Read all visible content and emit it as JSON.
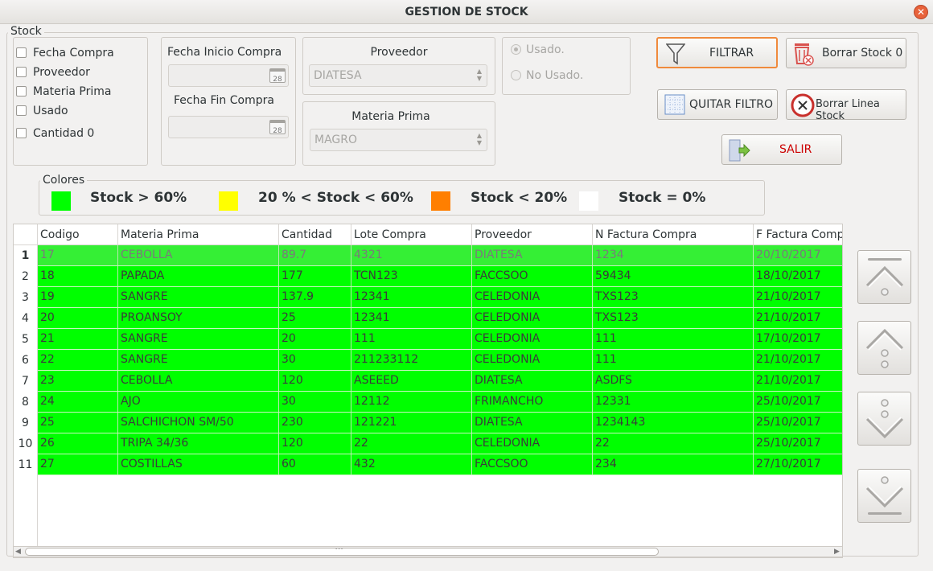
{
  "window": {
    "title": "GESTION DE STOCK"
  },
  "stock_group": {
    "title": "Stock",
    "checkboxes": [
      "Fecha Compra",
      "Proveedor",
      "Materia Prima",
      "Usado",
      "Cantidad 0"
    ]
  },
  "dates": {
    "start_label": "Fecha Inicio Compra",
    "end_label": "Fecha Fin Compra",
    "cal_icon_text": "28"
  },
  "proveedor": {
    "label": "Proveedor",
    "value": "DIATESA"
  },
  "materia": {
    "label": "Materia Prima",
    "value": "MAGRO"
  },
  "usage": {
    "used": "Usado.",
    "not_used": "No Usado."
  },
  "buttons": {
    "filter": "FILTRAR",
    "delete_stock0": "Borrar Stock 0",
    "remove_filter": "QUITAR FILTRO",
    "delete_line": "Borrar Linea Stock",
    "exit": "SALIR"
  },
  "legend": {
    "title": "Colores",
    "items": [
      {
        "color": "#00ff00",
        "label": "Stock > 60%"
      },
      {
        "color": "#ffff00",
        "label": "20 % < Stock < 60%"
      },
      {
        "color": "#ff7f00",
        "label": "Stock < 20%"
      },
      {
        "color": "#ffffff",
        "label": "Stock = 0%"
      }
    ]
  },
  "table": {
    "columns": [
      "Codigo",
      "Materia Prima",
      "Cantidad",
      "Lote Compra",
      "Proveedor",
      "N Factura Compra",
      "F Factura Compra"
    ],
    "row_numbers": [
      "1",
      "2",
      "3",
      "4",
      "5",
      "6",
      "7",
      "8",
      "9",
      "10",
      "11"
    ],
    "rows": [
      [
        "17",
        "CEBOLLA",
        "89.7",
        "4321",
        "DIATESA",
        "1234",
        "20/10/2017"
      ],
      [
        "18",
        "PAPADA",
        "177",
        "TCN123",
        "FACCSOO",
        "59434",
        "18/10/2017"
      ],
      [
        "19",
        "SANGRE",
        "137.9",
        "12341",
        "CELEDONIA",
        "TXS123",
        "21/10/2017"
      ],
      [
        "20",
        "PROANSOY",
        "25",
        "12341",
        "CELEDONIA",
        "TXS123",
        "21/10/2017"
      ],
      [
        "21",
        "SANGRE",
        "20",
        "111",
        "CELEDONIA",
        "111",
        "17/10/2017"
      ],
      [
        "22",
        "SANGRE",
        "30",
        "211233112",
        "CELEDONIA",
        "111",
        "21/10/2017"
      ],
      [
        "23",
        "CEBOLLA",
        "120",
        "ASEEED",
        "DIATESA",
        "ASDFS",
        "21/10/2017"
      ],
      [
        "24",
        "AJO",
        "30",
        "12112",
        "FRIMANCHO",
        "12331",
        "25/10/2017"
      ],
      [
        "25",
        "SALCHICHON SM/50",
        "230",
        "121221",
        "DIATESA",
        "1234143",
        "25/10/2017"
      ],
      [
        "26",
        "TRIPA 34/36",
        "120",
        "22",
        "CELEDONIA",
        "22",
        "25/10/2017"
      ],
      [
        "27",
        "COSTILLAS",
        "60",
        "432",
        "FACCSOO",
        "234",
        "27/10/2017"
      ]
    ]
  },
  "icons": {
    "filter": "funnel-icon",
    "delete_stock0": "trash-icon",
    "remove_filter": "grid-icon",
    "delete_line": "delete-circle-icon",
    "exit": "exit-door-icon",
    "close": "close-icon"
  },
  "close_glyph": "✕",
  "scroll_grip": "⋮"
}
